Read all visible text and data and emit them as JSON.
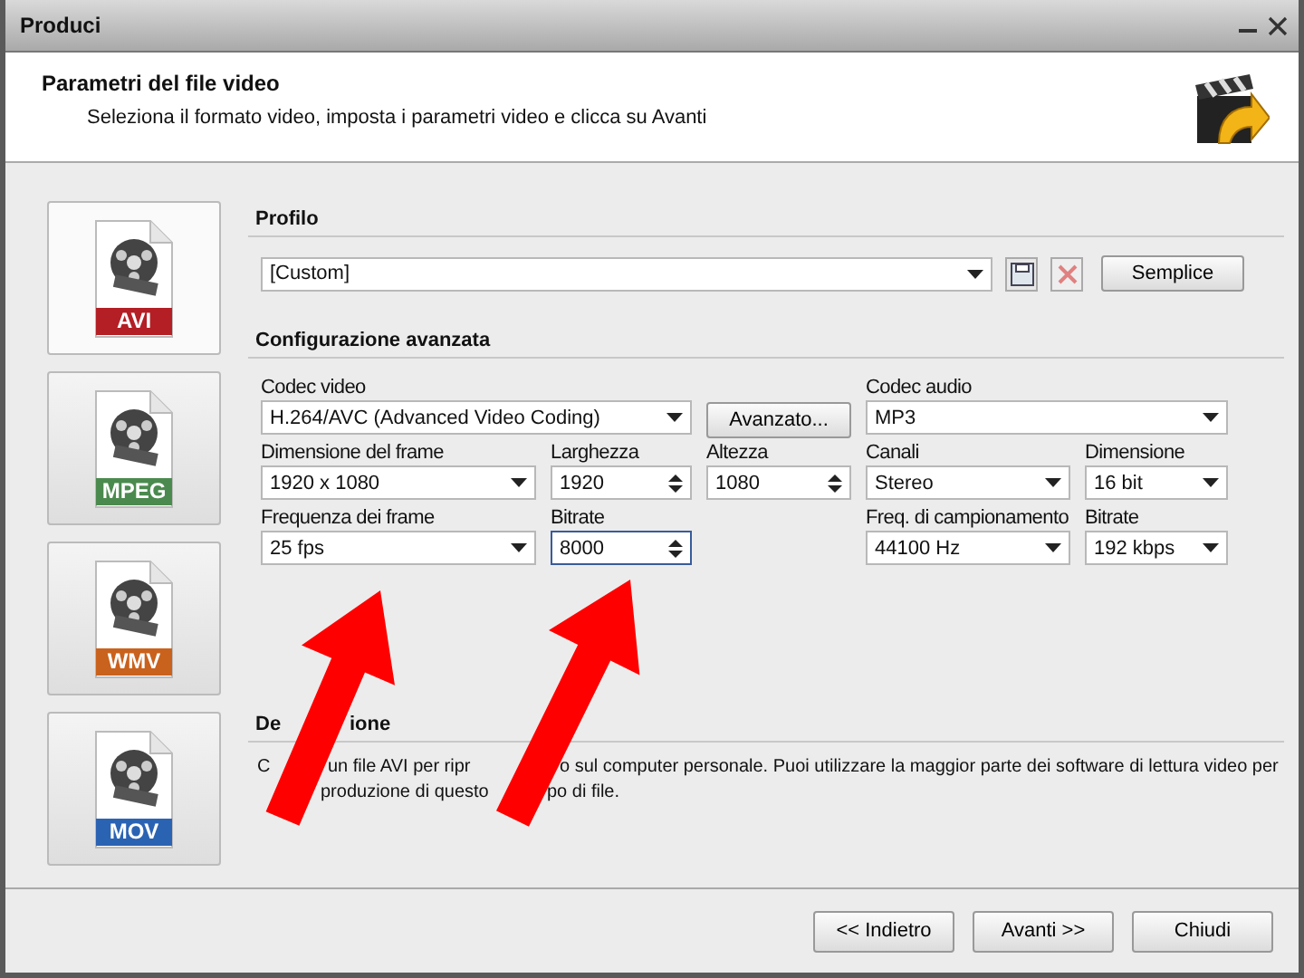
{
  "window": {
    "title": "Produci"
  },
  "header": {
    "title": "Parametri del file video",
    "subtitle": "Seleziona il formato video, imposta i parametri video e clicca su Avanti"
  },
  "formats": [
    {
      "label": "AVI",
      "color": "#b31f24",
      "selected": true
    },
    {
      "label": "MPEG",
      "color": "#4b8a4e",
      "selected": false
    },
    {
      "label": "WMV",
      "color": "#c9621c",
      "selected": false
    },
    {
      "label": "MOV",
      "color": "#2b63b3",
      "selected": false
    }
  ],
  "profile": {
    "heading": "Profilo",
    "value": "[Custom]",
    "button": "Semplice"
  },
  "advanced": {
    "heading": "Configurazione avanzata",
    "fields": [
      {
        "kind": "select",
        "label": "Codec video",
        "value": "H.264/AVC (Advanced Video Coding)"
      },
      {
        "kind": "button",
        "label": "Avanzato..."
      },
      {
        "kind": "select",
        "label": "Codec audio",
        "value": "MP3"
      },
      {
        "kind": "select",
        "label": "Dimensione del frame",
        "value": "1920 x 1080"
      },
      {
        "kind": "spin",
        "label": "Larghezza",
        "value": "1920",
        "focused": false
      },
      {
        "kind": "spin",
        "label": "Altezza",
        "value": "1080",
        "focused": false
      },
      {
        "kind": "select",
        "label": "Canali",
        "value": "Stereo"
      },
      {
        "kind": "select",
        "label": "Dimensione",
        "value": "16 bit"
      },
      {
        "kind": "select",
        "label": "Frequenza dei frame",
        "value": "25 fps"
      },
      {
        "kind": "spin",
        "label": "Bitrate",
        "value": "8000",
        "focused": true
      },
      {
        "kind": "select",
        "label": "Freq. di campionamento",
        "value": "44100 Hz"
      },
      {
        "kind": "select",
        "label": "Bitrate",
        "value": "192 kbps"
      }
    ]
  },
  "description": {
    "heading_parts": [
      "De",
      "ione"
    ],
    "lines": [
      [
        "C",
        "un file AVI per ripr",
        "o sul computer personale. Puoi utilizzare la maggior parte dei software di lettura video per"
      ],
      [
        "produzione di questo",
        "po di file."
      ]
    ]
  },
  "buttons": [
    {
      "label": "<< Indietro"
    },
    {
      "label": "Avanti >>"
    },
    {
      "label": "Chiudi"
    }
  ]
}
